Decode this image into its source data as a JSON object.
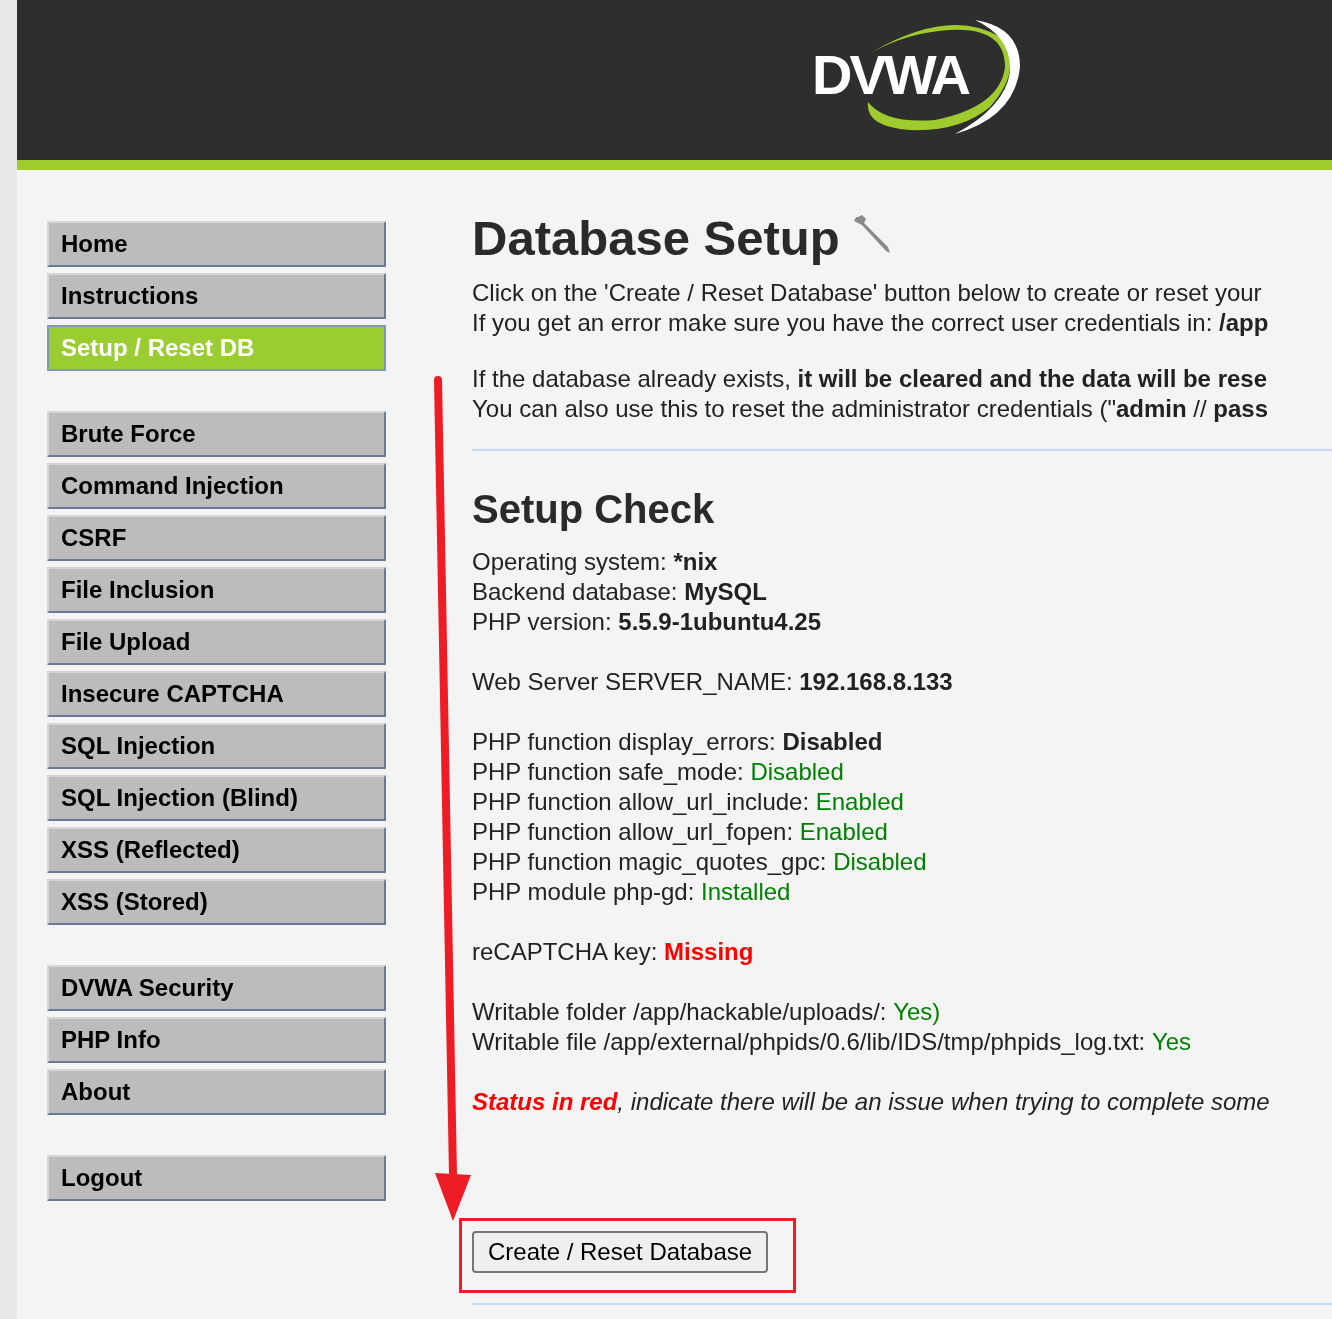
{
  "logo": "DVWA",
  "menu_groups": [
    [
      {
        "label": "Home",
        "selected": false
      },
      {
        "label": "Instructions",
        "selected": false
      },
      {
        "label": "Setup / Reset DB",
        "selected": true
      }
    ],
    [
      {
        "label": "Brute Force",
        "selected": false
      },
      {
        "label": "Command Injection",
        "selected": false
      },
      {
        "label": "CSRF",
        "selected": false
      },
      {
        "label": "File Inclusion",
        "selected": false
      },
      {
        "label": "File Upload",
        "selected": false
      },
      {
        "label": "Insecure CAPTCHA",
        "selected": false
      },
      {
        "label": "SQL Injection",
        "selected": false
      },
      {
        "label": "SQL Injection (Blind)",
        "selected": false
      },
      {
        "label": "XSS (Reflected)",
        "selected": false
      },
      {
        "label": "XSS (Stored)",
        "selected": false
      }
    ],
    [
      {
        "label": "DVWA Security",
        "selected": false
      },
      {
        "label": "PHP Info",
        "selected": false
      },
      {
        "label": "About",
        "selected": false
      }
    ],
    [
      {
        "label": "Logout",
        "selected": false
      }
    ]
  ],
  "title": "Database Setup",
  "intro_paragraphs": [
    [
      "Click on the 'Create / Reset Database' button below to create or reset your",
      "If you get an error make sure you have the correct user credentials in: **/app**"
    ],
    [
      "If the database already exists, **it will be cleared and the data will be rese**",
      "You can also use this to reset the administrator credentials (\"**admin** // **pass**"
    ]
  ],
  "check_title": "Setup Check",
  "check_groups": [
    [
      {
        "label": "Operating system: ",
        "value": "*nix",
        "kind": "bold"
      },
      {
        "label": "Backend database: ",
        "value": "MySQL",
        "kind": "bold"
      },
      {
        "label": "PHP version: ",
        "value": "5.5.9-1ubuntu4.25",
        "kind": "bold"
      }
    ],
    [
      {
        "label": "Web Server SERVER_NAME: ",
        "value": "192.168.8.133",
        "kind": "bold"
      }
    ],
    [
      {
        "label": "PHP function display_errors: ",
        "value": "Disabled",
        "kind": "bold"
      },
      {
        "label": "PHP function safe_mode: ",
        "value": "Disabled",
        "kind": "ok"
      },
      {
        "label": "PHP function allow_url_include: ",
        "value": "Enabled",
        "kind": "ok"
      },
      {
        "label": "PHP function allow_url_fopen: ",
        "value": "Enabled",
        "kind": "ok"
      },
      {
        "label": "PHP function magic_quotes_gpc: ",
        "value": "Disabled",
        "kind": "ok"
      },
      {
        "label": "PHP module php-gd: ",
        "value": "Installed",
        "kind": "ok"
      }
    ],
    [
      {
        "label": "reCAPTCHA key: ",
        "value": "Missing",
        "kind": "missing"
      }
    ],
    [
      {
        "label": "Writable folder /app/hackable/uploads/: ",
        "value": "Yes)",
        "kind": "ok"
      },
      {
        "label": "Writable file /app/external/phpids/0.6/lib/IDS/tmp/phpids_log.txt: ",
        "value": "Yes",
        "kind": "ok"
      }
    ]
  ],
  "status_note": {
    "highlight": "Status in red",
    "text": ", indicate there will be an issue when trying to complete some"
  },
  "button": "Create / Reset Database"
}
